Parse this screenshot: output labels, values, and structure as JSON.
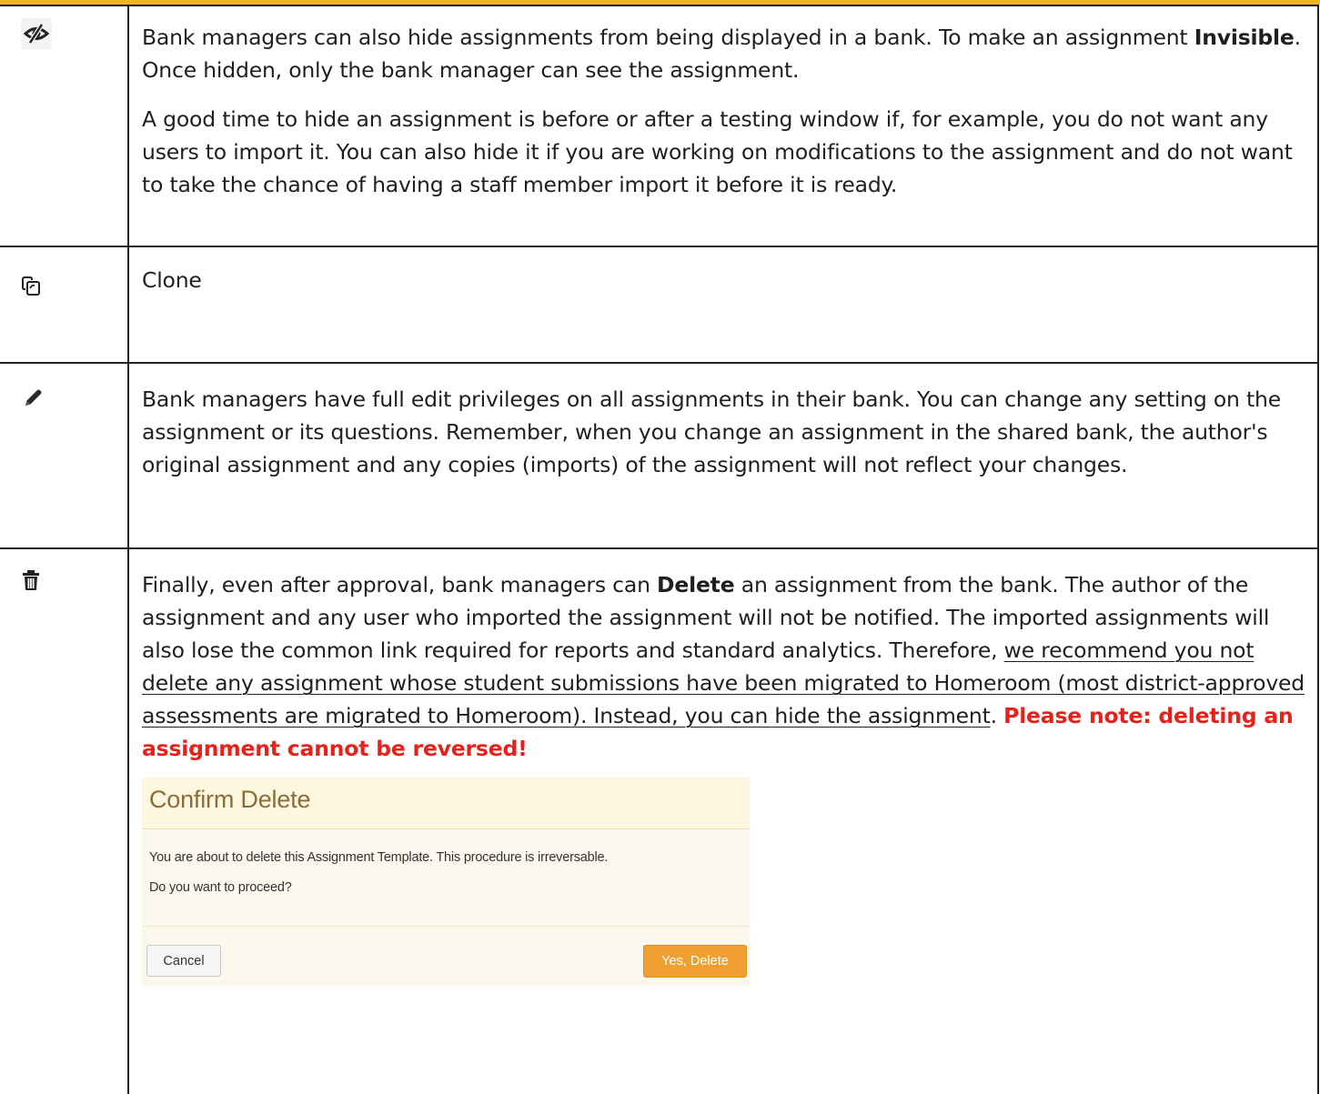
{
  "rows": [
    {
      "icon": "eye-slash-icon",
      "paragraphs": {
        "p1_a": "Bank managers can also hide assignments from being displayed in a bank. To make an assignment ",
        "p1_bold": "Invisible",
        "p1_b": ". Once hidden, only the bank manager can see the assignment.",
        "p2": "A good time to hide an assignment is before or after a testing window if, for example, you do not want any users to import it. You can also hide it if you are working on modifications to the assignment and do not want to take the chance of having a staff member import it before it is ready."
      }
    },
    {
      "icon": "clone-icon",
      "text": "Clone"
    },
    {
      "icon": "pencil-icon",
      "text": "Bank managers have full edit privileges on all assignments in their bank. You can change any setting on the assignment or its questions. Remember, when you change an assignment in the shared bank, the author's original assignment and any copies (imports) of the assignment will not reflect your changes."
    },
    {
      "icon": "trash-icon",
      "a": "Finally, even after approval, bank managers can ",
      "bold": "Delete",
      "b": " an assignment from the bank. The author of the assignment and any user who imported the assignment will not be notified. The imported assignments will also lose the common link required for reports and standard analytics. Therefore, ",
      "underlined": "we recommend you not delete any assignment whose student submissions have been migrated to Homeroom (most district-approved assessments are migrated to Homeroom). Instead, you can hide the assignment",
      "c": ". ",
      "warning": "Please note: deleting an assignment cannot be reversed!"
    }
  ],
  "dialog": {
    "title": "Confirm Delete",
    "line1": "You are about to delete this Assignment Template. This procedure is irreversable.",
    "line2": "Do you want to proceed?",
    "cancel_label": "Cancel",
    "confirm_label": "Yes, Delete"
  },
  "colors": {
    "top_bar": "#f0b429",
    "warning": "#e8221b",
    "confirm_button": "#f0a030",
    "dialog_header": "#fdf7e0"
  }
}
